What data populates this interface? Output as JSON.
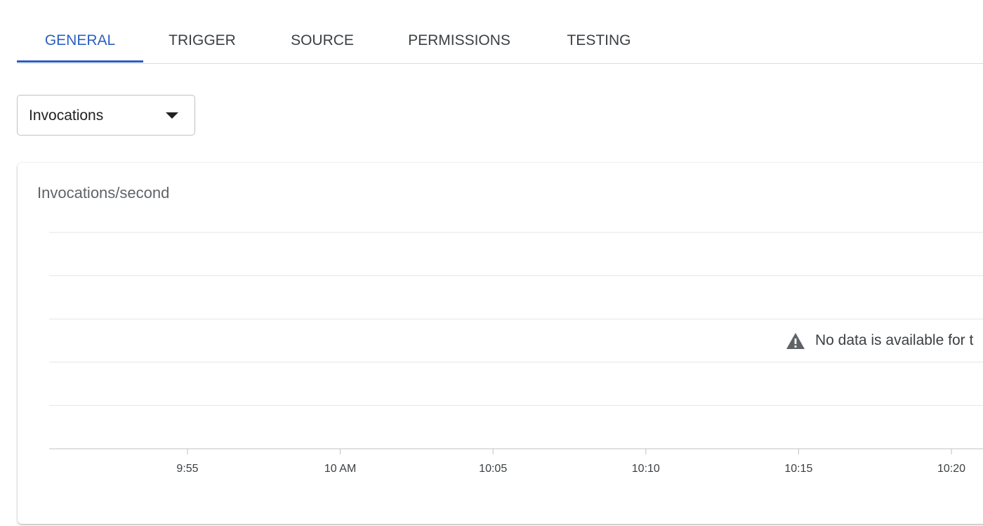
{
  "tabs": [
    {
      "label": "GENERAL",
      "active": true
    },
    {
      "label": "TRIGGER",
      "active": false
    },
    {
      "label": "SOURCE",
      "active": false
    },
    {
      "label": "PERMISSIONS",
      "active": false
    },
    {
      "label": "TESTING",
      "active": false
    }
  ],
  "metric_select": {
    "selected": "Invocations",
    "icon": "arrow-drop-down-icon"
  },
  "chart_card": {
    "no_data_message": "No data is available for t",
    "warning_icon": "warning-icon"
  },
  "colors": {
    "accent": "#2c5fc0",
    "text": "#3c4043",
    "muted": "#5f6368",
    "grid": "#e4e6e8",
    "axis": "#bdc1c6"
  },
  "chart_data": {
    "type": "line",
    "title": "Invocations/second",
    "x_ticks": [
      "9:55",
      "10 AM",
      "10:05",
      "10:10",
      "10:15",
      "10:20"
    ],
    "series": [],
    "grid": true,
    "gridline_count": 5
  }
}
